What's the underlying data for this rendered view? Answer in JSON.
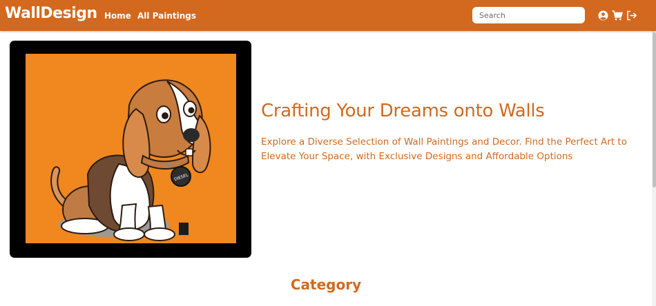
{
  "header": {
    "brand": "WallDesign",
    "nav": {
      "home": "Home",
      "all_paintings": "All Paintings"
    },
    "search": {
      "placeholder": "Search",
      "value": ""
    },
    "icons": [
      "user-circle-icon",
      "cart-icon",
      "logout-icon"
    ]
  },
  "hero": {
    "title": "Crafting Your Dreams onto Walls",
    "description": "Explore a Diverse Selection of Wall Paintings and Decor. Find the Perfect Art to Elevate Your Space, with Exclusive Designs and Affordable Options",
    "image": {
      "subject": "cartoon beagle puppy",
      "tag_text": "DIESEL"
    }
  },
  "category": {
    "title": "Category"
  },
  "colors": {
    "brand": "#d2691e",
    "art_background": "#f0871f",
    "frame": "#000000",
    "white": "#ffffff"
  }
}
